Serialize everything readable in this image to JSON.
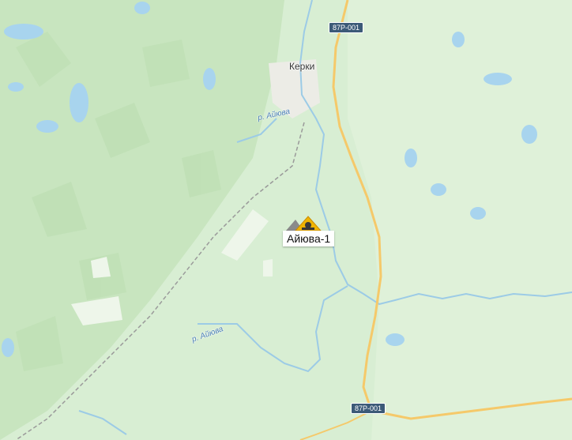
{
  "map": {
    "settlement": "Керки",
    "rivers": [
      "р. Айюва",
      "р. Айюва"
    ],
    "road_shields": [
      "87Р-001",
      "87Р-001"
    ],
    "poi": {
      "label": "Айюва-1",
      "icon": "mining-site-icon"
    },
    "colors": {
      "forest": "#c9e6c0",
      "meadow": "#dff0d8",
      "water": "#a8d4ee",
      "road": "#f5c96a",
      "railway": "#9a9a9a",
      "settlement": "#eeeeea",
      "poi": "#f0b400"
    }
  }
}
